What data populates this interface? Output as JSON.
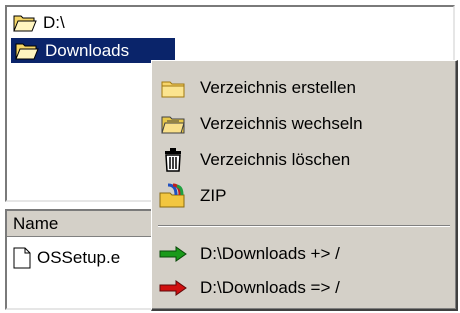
{
  "tree": {
    "root_label": "D:\\",
    "selected_label": "Downloads"
  },
  "file_list": {
    "column_name": "Name",
    "rows": [
      {
        "name": "OSSetup.e"
      }
    ]
  },
  "context_menu": {
    "items": [
      {
        "label": "Verzeichnis erstellen",
        "icon": "folder-new-icon"
      },
      {
        "label": "Verzeichnis wechseln",
        "icon": "folder-open-icon"
      },
      {
        "label": "Verzeichnis löschen",
        "icon": "trash-icon"
      },
      {
        "label": "ZIP",
        "icon": "zip-icon"
      }
    ],
    "transfer_items": [
      {
        "label": "D:\\Downloads +> /",
        "icon": "green-arrow-icon",
        "color": "#1a9a1a"
      },
      {
        "label": "D:\\Downloads => /",
        "icon": "red-arrow-icon",
        "color": "#d01010"
      }
    ]
  },
  "colors": {
    "selection": "#0a246a",
    "menu_bg": "#d4d0c8"
  }
}
